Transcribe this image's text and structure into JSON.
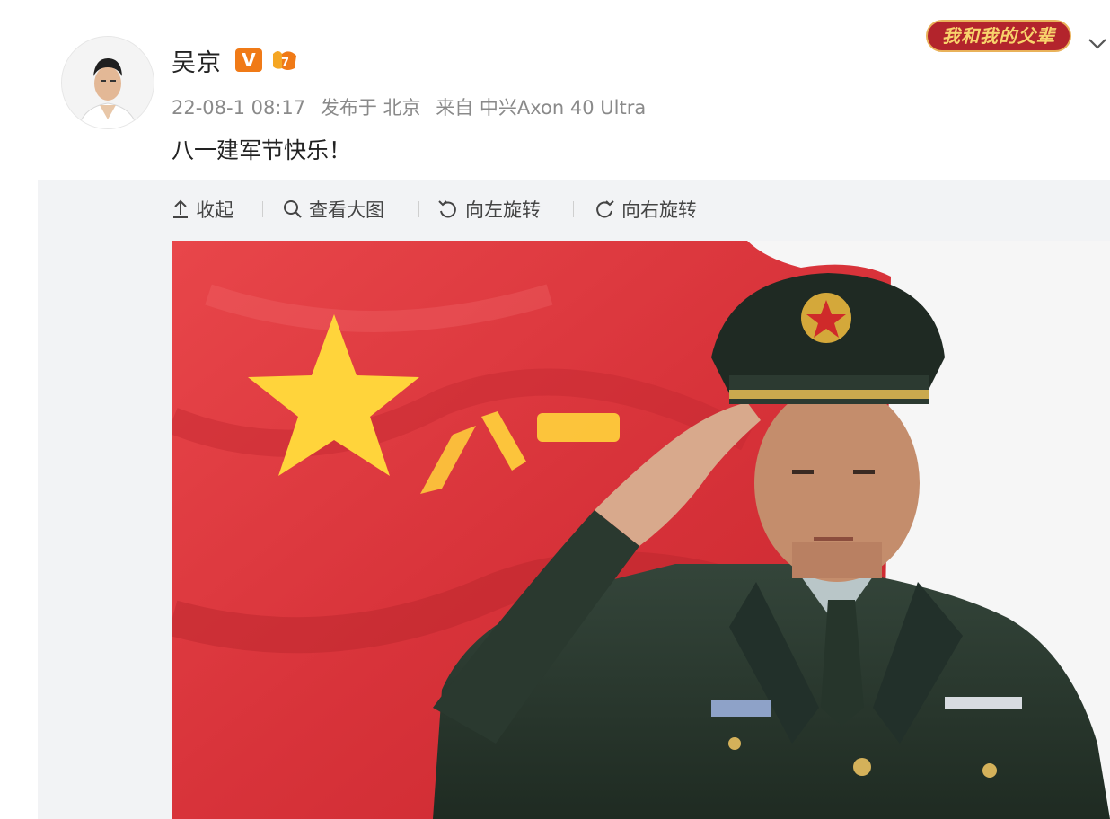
{
  "post": {
    "username": "吴京",
    "verified_badge": "V",
    "timestamp": "22-08-1 08:17",
    "location": "发布于 北京",
    "source": "来自 中兴Axon 40 Ultra",
    "text": "八一建军节快乐！"
  },
  "topic_badge": {
    "label": "我和我的父辈"
  },
  "toolbar": {
    "collapse_label": "收起",
    "view_large_label": "查看大图",
    "rotate_left_label": "向左旋转",
    "rotate_right_label": "向右旋转"
  },
  "colors": {
    "flag_red": "#de2f35",
    "star_yellow": "#ffd43b",
    "uniform_green": "#2b3a2e",
    "verified_orange": "#f07a17"
  },
  "icons": [
    "collapse-arrow-icon",
    "search-icon",
    "rotate-left-icon",
    "rotate-right-icon",
    "chevron-down-icon"
  ]
}
